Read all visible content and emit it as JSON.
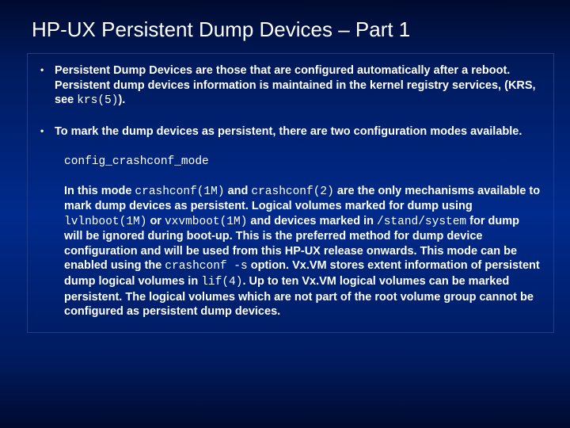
{
  "title": "HP-UX Persistent Dump Devices – Part 1",
  "bullets": [
    {
      "pre": "Persistent Dump Devices are those that are configured automatically after a reboot. Persistent dump devices information is maintained in the kernel registry services, (KRS, see ",
      "code": "krs(5)",
      "post": ")."
    },
    {
      "pre": "To mark the dump devices as persistent, there are two configuration modes available.",
      "code": "",
      "post": ""
    }
  ],
  "mode_label": "config_crashconf_mode",
  "para": {
    "p1a": "In this mode ",
    "c1": "crashconf(1M)",
    "p1b": " and ",
    "c2": "crashconf(2)",
    "p1c": " are the only mechanisms available to mark dump devices as persistent. Logical volumes marked for dump using ",
    "c3": "lvlnboot(1M)",
    "p1d": " or ",
    "c4": "vxvmboot(1M)",
    "p1e": " and devices marked in ",
    "c5": "/stand/system",
    "p1f": " for dump will be ignored during boot-up. This is the preferred method for dump device configuration and will be used from this HP-UX release onwards. This mode can be enabled using the ",
    "c6": "crashconf -s",
    "p1g": " option. Vx.VM stores extent information of persistent dump logical volumes in ",
    "c7": "lif(4)",
    "p1h": ". ",
    "tail": "Up to ten Vx.VM logical volumes can be marked persistent. The logical volumes which are not part of the root volume group cannot be configured as persistent dump devices."
  }
}
